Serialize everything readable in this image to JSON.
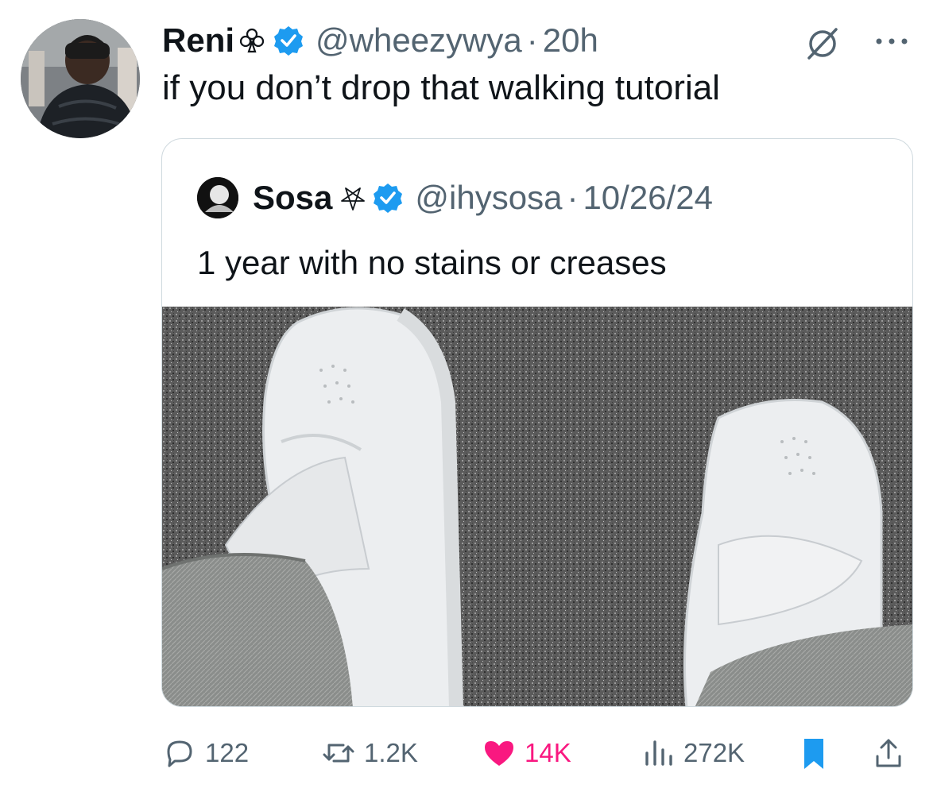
{
  "tweet": {
    "author_name": "Reni",
    "author_handle": "@wheezywya",
    "separator": "·",
    "time": "20h",
    "text": "if you don’t drop that walking tutorial"
  },
  "quoted_tweet": {
    "author_name": "Sosa",
    "author_handle": "@ihysosa",
    "separator": "·",
    "date": "10/26/24",
    "text": "1 year with no stains or creases"
  },
  "actions": {
    "replies": "122",
    "reposts": "1.2K",
    "likes": "14K",
    "views": "272K"
  },
  "icons": {
    "club": "club-icon",
    "verified": "verified-badge-icon",
    "grok": "grok-icon",
    "more": "more-icon",
    "pentagram": "pentagram-icon",
    "reply": "reply-icon",
    "repost": "repost-icon",
    "like": "heart-icon",
    "views": "views-icon",
    "bookmark": "bookmark-icon",
    "share": "share-icon"
  },
  "colors": {
    "verified": "#1d9bf0",
    "like": "#f91880",
    "bookmark": "#1d9bf0",
    "secondary_text": "#536471"
  }
}
